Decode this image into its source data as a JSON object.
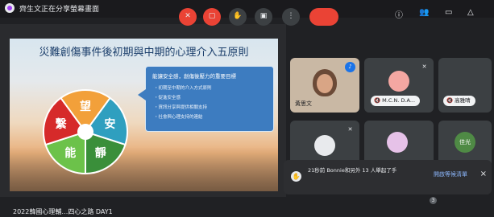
{
  "presenter": {
    "title": "齊生文正在分享螢幕畫面"
  },
  "slide": {
    "title": "災難創傷事件後初期與中期的心理介入五原則",
    "callout": {
      "heading": "能讓安全感，創傷後壓力的重要目標",
      "bullets": [
        "・初期至中期的介入方式原則",
        "・促進安全感",
        "・資訊分享與提供相關支持",
        "・社會與心理支持的連結"
      ]
    },
    "wheel": [
      {
        "label": "望",
        "color": "#f2a03a"
      },
      {
        "label": "安",
        "color": "#2f9fbf"
      },
      {
        "label": "靜",
        "color": "#3a8f3a"
      },
      {
        "label": "能",
        "color": "#6cc24a"
      },
      {
        "label": "繫",
        "color": "#d62a2a"
      }
    ]
  },
  "participants": [
    {
      "name": "黃思文",
      "speaking": true
    },
    {
      "name": "M.C.N. D.A...",
      "muted": true
    },
    {
      "name": "高雅晴",
      "muted": true
    },
    {
      "name": "",
      "muted": true
    },
    {
      "name": "",
      "muted": false
    },
    {
      "name": "佳光",
      "initial": "佳光"
    }
  ],
  "notification": {
    "text": "21秒前 Bonnie和另外 13 人舉起了手",
    "action": "開啟等候清單",
    "close": "×"
  },
  "meeting": {
    "name": "2022韓國心理輔…四心之路 DAY1"
  },
  "controls": {
    "more": "⋮",
    "badge": "3"
  },
  "icons": {
    "mic_off": "mic-off-icon",
    "cam_off": "videocam-off-icon",
    "hand": "hand-icon",
    "present": "present-icon",
    "more": "more-icon",
    "end": "call-end-icon",
    "info": "info-icon",
    "people": "people-icon",
    "chat": "chat-icon",
    "activities": "activities-icon"
  },
  "colors": {
    "danger": "#ea4335",
    "accent": "#8ab4f8",
    "tile": "#3c4043"
  }
}
